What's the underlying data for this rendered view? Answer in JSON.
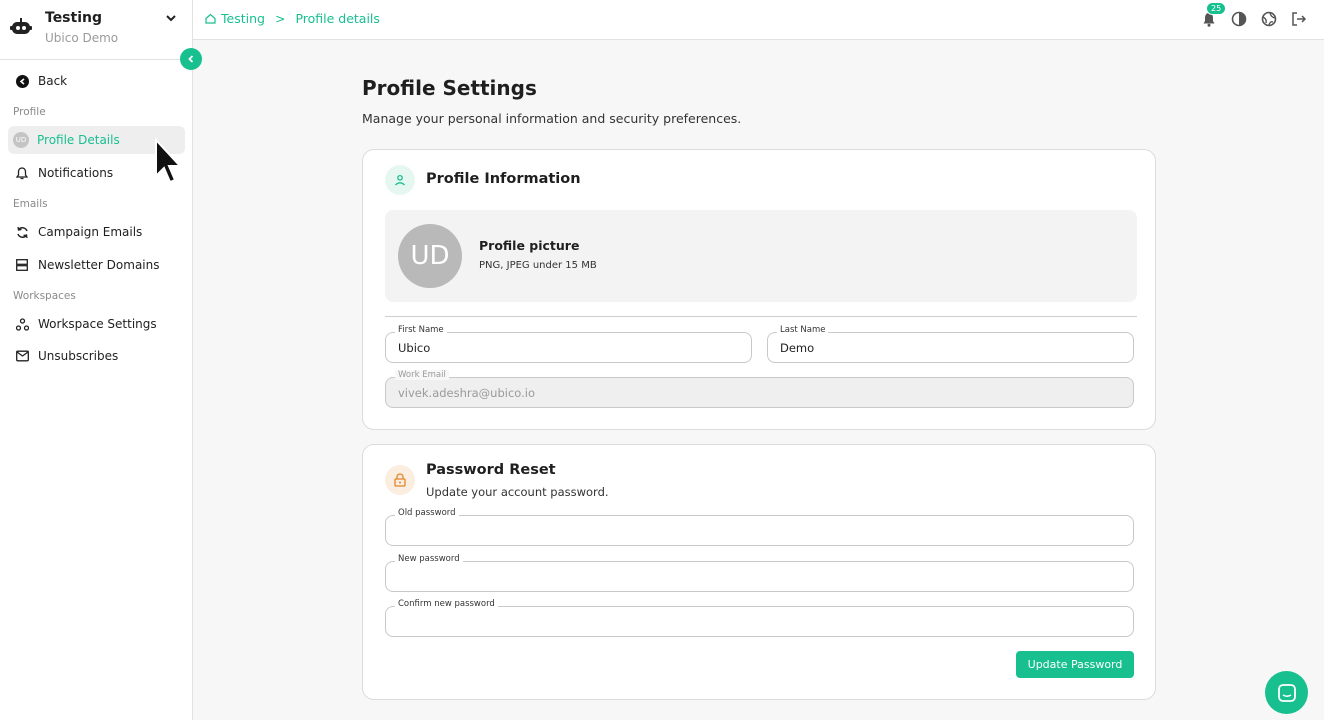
{
  "workspace": {
    "name": "Testing",
    "subtitle": "Ubico Demo"
  },
  "sidebar": {
    "back_label": "Back",
    "sections": [
      {
        "label": "Profile"
      },
      {
        "label": "Emails"
      },
      {
        "label": "Workspaces"
      }
    ],
    "items": [
      {
        "label": "Profile Details",
        "avatar": "UD"
      },
      {
        "label": "Notifications"
      },
      {
        "label": "Campaign Emails"
      },
      {
        "label": "Newsletter Domains"
      },
      {
        "label": "Workspace Settings"
      },
      {
        "label": "Unsubscribes"
      }
    ]
  },
  "breadcrumb": {
    "items": [
      "Testing",
      "Profile details"
    ],
    "separator": ">"
  },
  "topbar": {
    "notification_count": "25"
  },
  "page": {
    "title": "Profile Settings",
    "subtitle": "Manage your personal information and security preferences."
  },
  "profile_card": {
    "title": "Profile Information",
    "avatar_initials": "UD",
    "picture_title": "Profile picture",
    "picture_hint": "PNG, JPEG under 15 MB",
    "first_name_label": "First Name",
    "first_name_value": "Ubico",
    "last_name_label": "Last Name",
    "last_name_value": "Demo",
    "email_label": "Work Email",
    "email_value": "vivek.adeshra@ubico.io"
  },
  "password_card": {
    "title": "Password Reset",
    "subtitle": "Update your account password.",
    "old_label": "Old password",
    "new_label": "New password",
    "confirm_label": "Confirm new password",
    "submit_label": "Update Password"
  },
  "colors": {
    "accent": "#18c08f",
    "lock": "#e0852c"
  }
}
